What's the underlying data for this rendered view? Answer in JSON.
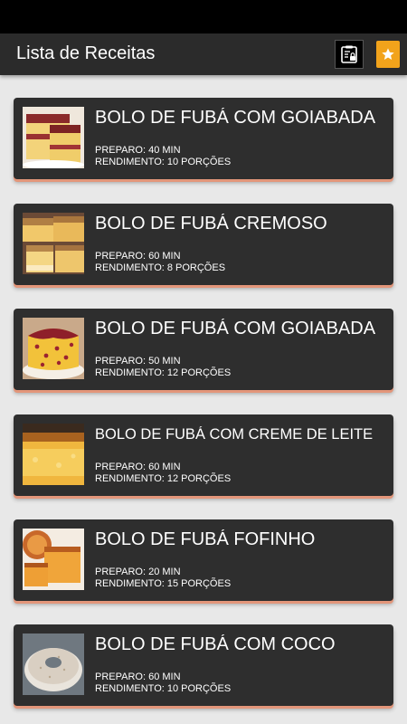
{
  "app_bar": {
    "title": "Lista de Receitas",
    "privacy_icon": "privacy-lock-icon",
    "bookmark_icon": "star-bookmark-icon",
    "accent": "#f2a31b"
  },
  "recipes": [
    {
      "title": "BOLO DE FUBÁ COM GOIABADA",
      "prep": "PREPARO: 40 MIN",
      "yield": "RENDIMENTO: 10 PORÇÕES"
    },
    {
      "title": "BOLO DE FUBÁ CREMOSO",
      "prep": "PREPARO: 60 MIN",
      "yield": "RENDIMENTO: 8 PORÇÕES"
    },
    {
      "title": "BOLO DE FUBÁ COM GOIABADA",
      "prep": "PREPARO: 50 MIN",
      "yield": "RENDIMENTO: 12 PORÇÕES"
    },
    {
      "title": "BOLO DE FUBÁ COM CREME DE LEITE",
      "prep": "PREPARO: 60 MIN",
      "yield": "RENDIMENTO: 12 PORÇÕES"
    },
    {
      "title": "BOLO DE FUBÁ FOFINHO",
      "prep": "PREPARO: 20 MIN",
      "yield": "RENDIMENTO: 15 PORÇÕES"
    },
    {
      "title": "BOLO DE FUBÁ COM COCO",
      "prep": "PREPARO: 60 MIN",
      "yield": "RENDIMENTO: 10 PORÇÕES"
    }
  ]
}
